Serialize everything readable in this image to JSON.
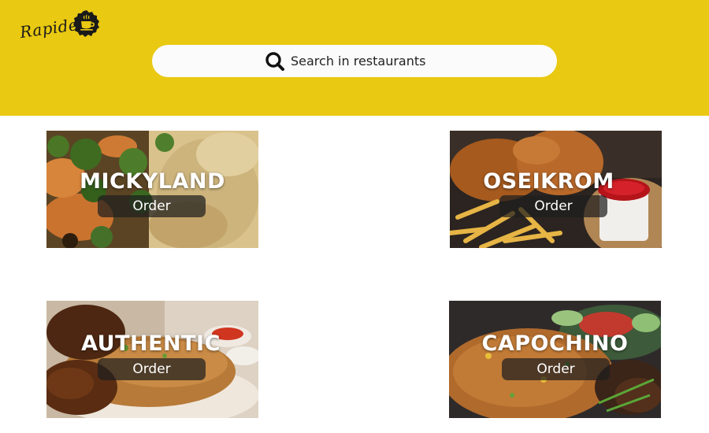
{
  "header": {
    "logo_text": "Rapide",
    "colors": {
      "background": "#e9c911",
      "search_bg": "#fbfbfb"
    }
  },
  "search": {
    "placeholder": "Search in restaurants",
    "icon": "search-icon"
  },
  "restaurants": [
    {
      "name": "MICKYLAND",
      "order_label": "Order"
    },
    {
      "name": "OSEIKROM",
      "order_label": "Order"
    },
    {
      "name": "AUTHENTIC",
      "order_label": "Order"
    },
    {
      "name": "CAPOCHINO",
      "order_label": "Order"
    }
  ]
}
